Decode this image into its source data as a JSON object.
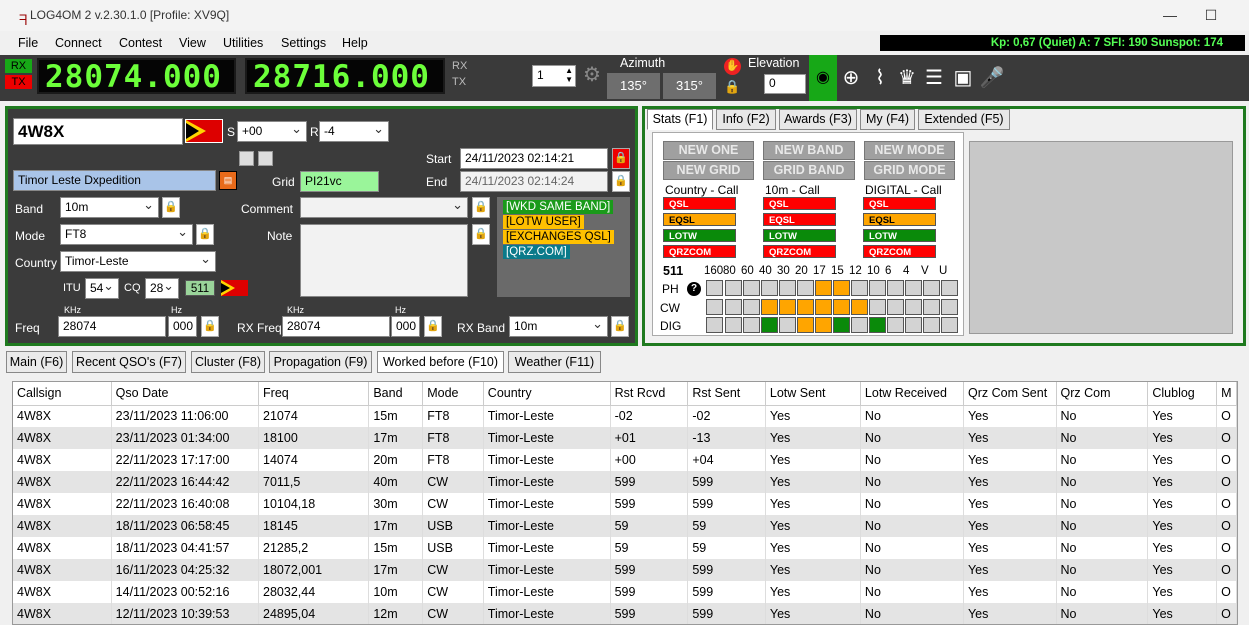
{
  "window": {
    "title": "LOG4OM 2 v.2.30.1.0 [Profile: XV9Q]",
    "minimize": "—",
    "maximize": "☐"
  },
  "menu": [
    "File",
    "Connect",
    "Contest",
    "View",
    "Utilities",
    "Settings",
    "Help"
  ],
  "status_line": "Kp: 0,67 (Quiet)  A: 7  SFI: 190 Sunspot: 174",
  "toolbar": {
    "rx_label": "RX",
    "tx_label": "TX",
    "freq_rx": "28074.000",
    "freq_tx": "28716.000",
    "vfo_rx": "RX",
    "vfo_tx": "TX",
    "step": "1",
    "azimuth_label": "Azimuth",
    "az_short": "135°",
    "az_long": "315°",
    "elevation_label": "Elevation",
    "elevation": "0"
  },
  "qso": {
    "callsign": "4W8X",
    "s_label": "S",
    "r_label": "R",
    "rst_sent": "+00",
    "rst_rcvd": "-4",
    "start_label": "Start",
    "start": "24/11/2023 02:14:21",
    "end_label": "End",
    "end": "24/11/2023 02:14:24",
    "name": "Timor Leste Dxpedition",
    "grid_label": "Grid",
    "grid": "PI21vc",
    "band_label": "Band",
    "band": "10m",
    "comment_label": "Comment",
    "comment": "",
    "mode_label": "Mode",
    "mode": "FT8",
    "note_label": "Note",
    "country_label": "Country",
    "country": "Timor-Leste",
    "itu_label": "ITU",
    "itu": "54",
    "cq_label": "CQ",
    "cq": "28",
    "dxcc": "511",
    "freq_label": "Freq",
    "freq": "28074",
    "freq_hz": "000",
    "khz": "KHz",
    "hz": "Hz",
    "rxfreq_label": "RX Freq",
    "rxfreq": "28074",
    "rxfreq_hz": "000",
    "rxband_label": "RX Band",
    "rxband": "10m",
    "tags": [
      "[WKD SAME BAND]",
      "[LOTW USER]",
      "[EXCHANGES QSL]",
      "[QRZ.COM]"
    ]
  },
  "stats": {
    "tabs": [
      "Stats (F1)",
      "Info (F2)",
      "Awards (F3)",
      "My (F4)",
      "Extended (F5)"
    ],
    "buttons": [
      "NEW ONE",
      "NEW BAND",
      "NEW MODE",
      "NEW GRID",
      "GRID BAND",
      "GRID MODE"
    ],
    "col_titles": [
      "Country - Call",
      "10m - Call",
      "DIGITAL - Call"
    ],
    "chips": [
      "QSL",
      "EQSL",
      "LOTW",
      "QRZCOM"
    ],
    "dxcc": "511",
    "bands": [
      "160",
      "80",
      "60",
      "40",
      "30",
      "20",
      "17",
      "15",
      "12",
      "10",
      "6",
      "4",
      "V",
      "U"
    ],
    "modes": [
      "PH",
      "CW",
      "DIG"
    ],
    "help_icon": "?",
    "grid": {
      "PH": [
        0,
        0,
        0,
        0,
        0,
        0,
        1,
        1,
        0,
        0,
        0,
        0,
        0,
        0
      ],
      "CW": [
        0,
        0,
        0,
        1,
        1,
        1,
        1,
        1,
        1,
        0,
        0,
        0,
        0,
        0
      ],
      "DIG": [
        0,
        0,
        0,
        2,
        0,
        1,
        1,
        2,
        0,
        2,
        0,
        0,
        0,
        0
      ]
    }
  },
  "bottom_tabs": [
    "Main (F6)",
    "Recent QSO's (F7)",
    "Cluster (F8)",
    "Propagation (F9)",
    "Worked before (F10)",
    "Weather (F11)"
  ],
  "table": {
    "columns": [
      "Callsign",
      "Qso Date",
      "Freq",
      "Band",
      "Mode",
      "Country",
      "Rst Rcvd",
      "Rst Sent",
      "Lotw Sent",
      "Lotw Received",
      "Qrz Com Sent",
      "Qrz Com",
      "Clublog",
      "M"
    ],
    "rows": [
      [
        "4W8X",
        "23/11/2023 11:06:00",
        "21074",
        "15m",
        "FT8",
        "Timor-Leste",
        "-02",
        "-02",
        "Yes",
        "No",
        "Yes",
        "No",
        "Yes",
        "O"
      ],
      [
        "4W8X",
        "23/11/2023 01:34:00",
        "18100",
        "17m",
        "FT8",
        "Timor-Leste",
        "+01",
        "-13",
        "Yes",
        "No",
        "Yes",
        "No",
        "Yes",
        "O"
      ],
      [
        "4W8X",
        "22/11/2023 17:17:00",
        "14074",
        "20m",
        "FT8",
        "Timor-Leste",
        "+00",
        "+04",
        "Yes",
        "No",
        "Yes",
        "No",
        "Yes",
        "O"
      ],
      [
        "4W8X",
        "22/11/2023 16:44:42",
        "7011,5",
        "40m",
        "CW",
        "Timor-Leste",
        "599",
        "599",
        "Yes",
        "No",
        "Yes",
        "No",
        "Yes",
        "O"
      ],
      [
        "4W8X",
        "22/11/2023 16:40:08",
        "10104,18",
        "30m",
        "CW",
        "Timor-Leste",
        "599",
        "599",
        "Yes",
        "No",
        "Yes",
        "No",
        "Yes",
        "O"
      ],
      [
        "4W8X",
        "18/11/2023 06:58:45",
        "18145",
        "17m",
        "USB",
        "Timor-Leste",
        "59",
        "59",
        "Yes",
        "No",
        "Yes",
        "No",
        "Yes",
        "O"
      ],
      [
        "4W8X",
        "18/11/2023 04:41:57",
        "21285,2",
        "15m",
        "USB",
        "Timor-Leste",
        "59",
        "59",
        "Yes",
        "No",
        "Yes",
        "No",
        "Yes",
        "O"
      ],
      [
        "4W8X",
        "16/11/2023 04:25:32",
        "18072,001",
        "17m",
        "CW",
        "Timor-Leste",
        "599",
        "599",
        "Yes",
        "No",
        "Yes",
        "No",
        "Yes",
        "O"
      ],
      [
        "4W8X",
        "14/11/2023 00:52:16",
        "28032,44",
        "10m",
        "CW",
        "Timor-Leste",
        "599",
        "599",
        "Yes",
        "No",
        "Yes",
        "No",
        "Yes",
        "O"
      ],
      [
        "4W8X",
        "12/11/2023 10:39:53",
        "24895,04",
        "12m",
        "CW",
        "Timor-Leste",
        "599",
        "599",
        "Yes",
        "No",
        "Yes",
        "No",
        "Yes",
        "O"
      ]
    ]
  },
  "colors": {
    "accent_green": "#1f7a1f",
    "lcd": "#6cff3a",
    "panel": "#3b3b3b"
  }
}
